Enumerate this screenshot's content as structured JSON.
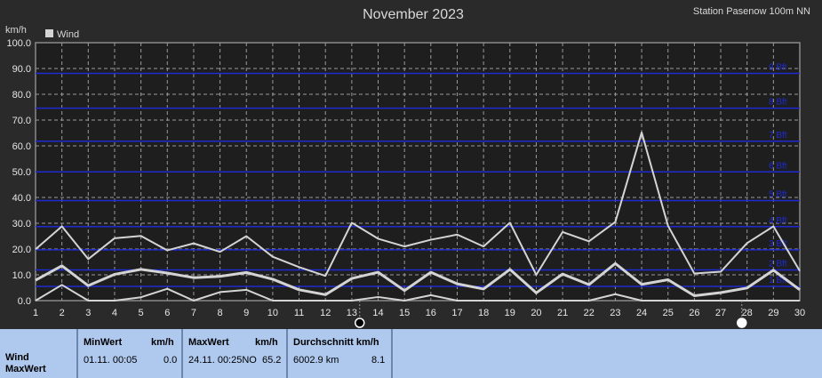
{
  "station": "Station Pasenow 100m NN",
  "chart_data": {
    "type": "line",
    "title": "November 2023",
    "ylabel": "km/h",
    "ylim": [
      0,
      100
    ],
    "yticks": [
      "0.0",
      "10.0",
      "20.0",
      "30.0",
      "40.0",
      "50.0",
      "60.0",
      "70.0",
      "80.0",
      "90.0",
      "100.0"
    ],
    "x": [
      1,
      2,
      3,
      4,
      5,
      6,
      7,
      8,
      9,
      10,
      11,
      12,
      13,
      14,
      15,
      16,
      17,
      18,
      19,
      20,
      21,
      22,
      23,
      24,
      25,
      26,
      27,
      28,
      29,
      30
    ],
    "legend": "Wind",
    "legend_position": "top-left",
    "grid": true,
    "series": [
      {
        "values": [
          19.9,
          28.8,
          16.1,
          24.2,
          25.1,
          19.5,
          22.2,
          18.9,
          25.0,
          17.0,
          13.0,
          9.6,
          30.2,
          24.0,
          21.0,
          23.6,
          25.6,
          21.0,
          30.2,
          10.0,
          26.6,
          23.0,
          30.5,
          65.2,
          29.0,
          10.5,
          11.2,
          22.3,
          28.8,
          11.5
        ]
      },
      {
        "values": [
          7.9,
          13.5,
          5.8,
          10.2,
          12.1,
          10.7,
          8.9,
          9.4,
          10.9,
          8.3,
          4.2,
          2.3,
          8.6,
          11.0,
          3.9,
          11.0,
          6.5,
          4.5,
          12.1,
          3.0,
          10.3,
          6.2,
          14.4,
          6.3,
          8.1,
          1.9,
          3.1,
          4.9,
          11.8,
          4.2
        ]
      },
      {
        "values": [
          0.0,
          6.1,
          0.0,
          0.0,
          1.3,
          4.6,
          0.0,
          3.3,
          4.2,
          0.0,
          0.0,
          0.0,
          0.0,
          1.4,
          0.0,
          2.1,
          0.0,
          0.0,
          0.0,
          0.0,
          0.0,
          0.0,
          2.5,
          0.0,
          0.0,
          0.0,
          0.0,
          0.0,
          0.0,
          0.0
        ]
      }
    ],
    "beaufort_lines": [
      {
        "value": 5.5,
        "label": "1 Bft"
      },
      {
        "value": 11.9,
        "label": "2 Bft"
      },
      {
        "value": 19.7,
        "label": "3 Bft"
      },
      {
        "value": 28.7,
        "label": "4 Bft"
      },
      {
        "value": 38.8,
        "label": "5 Bft"
      },
      {
        "value": 49.9,
        "label": "6 Bft"
      },
      {
        "value": 61.8,
        "label": "7 Bft"
      },
      {
        "value": 74.6,
        "label": "8 Bft"
      },
      {
        "value": 88.1,
        "label": "9 Bft"
      }
    ],
    "markers": [
      13.3,
      27.8
    ]
  },
  "summary": {
    "label_line1": "Wind",
    "label_line2": "MaxWert",
    "min": {
      "header": "MinWert",
      "unit": "km/h",
      "time": "01.11.  00:05",
      "value": "0.0"
    },
    "max": {
      "header": "MaxWert",
      "unit": "km/h",
      "time": "24.11.  00:25NO",
      "value": "65.2"
    },
    "avg": {
      "header": "Durchschnitt km/h",
      "distance": "6002.9 km",
      "value": "8.1"
    }
  }
}
